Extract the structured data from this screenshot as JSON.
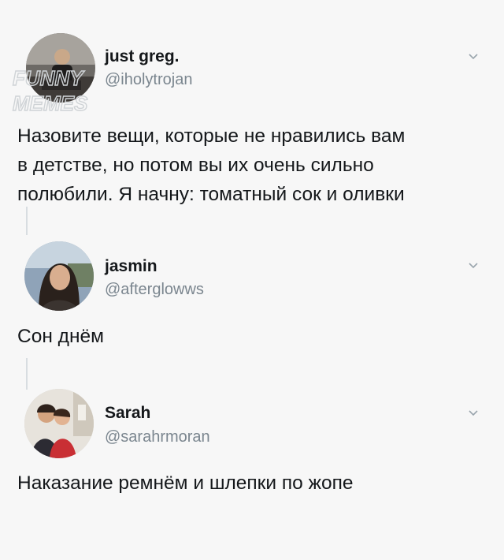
{
  "tweets": [
    {
      "name": "just greg.",
      "handle": "@iholytrojan",
      "text_lines": [
        "Назовите вещи, которые не нравились вам",
        "в детстве, но потом вы их очень сильно",
        "полюбили. Я начну: томатный сок и оливки"
      ]
    },
    {
      "name": "jasmin",
      "handle": "@afterglowws",
      "text_lines": [
        "Сон днём"
      ]
    },
    {
      "name": "Sarah",
      "handle": "@sarahrmoran",
      "text_lines": [
        "Наказание ремнём и шлепки по жопе"
      ]
    }
  ],
  "watermark": {
    "line1": "FUNNY",
    "line2": "MEMES"
  },
  "icons": {
    "menu": "chevron-down-icon",
    "avatar": "avatar-photo"
  },
  "colors": {
    "background": "#f7f7f7",
    "text": "#14171a",
    "handle": "#7b868f",
    "thread_line": "#d8dde1"
  }
}
